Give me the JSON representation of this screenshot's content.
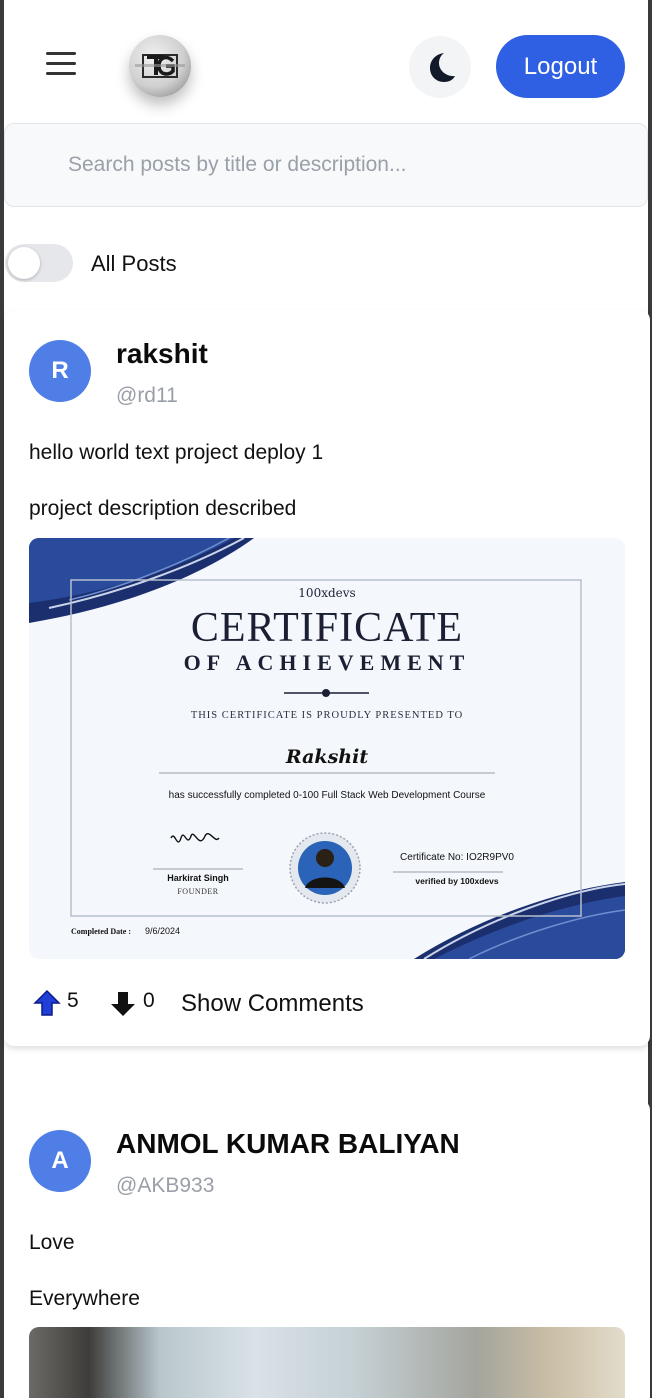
{
  "header": {
    "logout_label": "Logout"
  },
  "search": {
    "placeholder": "Search posts by title or description..."
  },
  "filter": {
    "toggle_label": "All Posts",
    "toggle_on": false
  },
  "posts": [
    {
      "avatar_letter": "R",
      "author_name": "rakshit",
      "author_handle": "@rd11",
      "title": "hello world text project deploy 1",
      "description": "project description described",
      "upvotes": "5",
      "downvotes": "0",
      "comments_label": "Show Comments",
      "certificate": {
        "brand": "100xdevs",
        "heading": "CERTIFICATE",
        "subheading": "OF ACHIEVEMENT",
        "presented_text": "THIS CERTIFICATE IS PROUDLY PRESENTED TO",
        "recipient": "Rakshit",
        "completion_text": "has successfully completed 0-100 Full Stack Web Development Course",
        "signer_name": "Harkirat Singh",
        "signer_role": "FOUNDER",
        "certificate_no": "Certificate No: IO2R9PV0",
        "verified_by": "verified by 100xdevs",
        "date_label": "Completed Date :",
        "date_value": "9/6/2024"
      }
    },
    {
      "avatar_letter": "A",
      "author_name": "ANMOL KUMAR BALIYAN",
      "author_handle": "@AKB933",
      "title": "Love",
      "description": "Everywhere"
    }
  ],
  "colors": {
    "primary": "#2f5fe3",
    "avatar": "#4f7fe6",
    "upvote": "#1f3fd6",
    "certificate_navy": "#1b2f6e"
  },
  "icons": [
    "menu-icon",
    "logo-icon",
    "moon-icon",
    "arrow-up-icon",
    "arrow-down-icon"
  ]
}
